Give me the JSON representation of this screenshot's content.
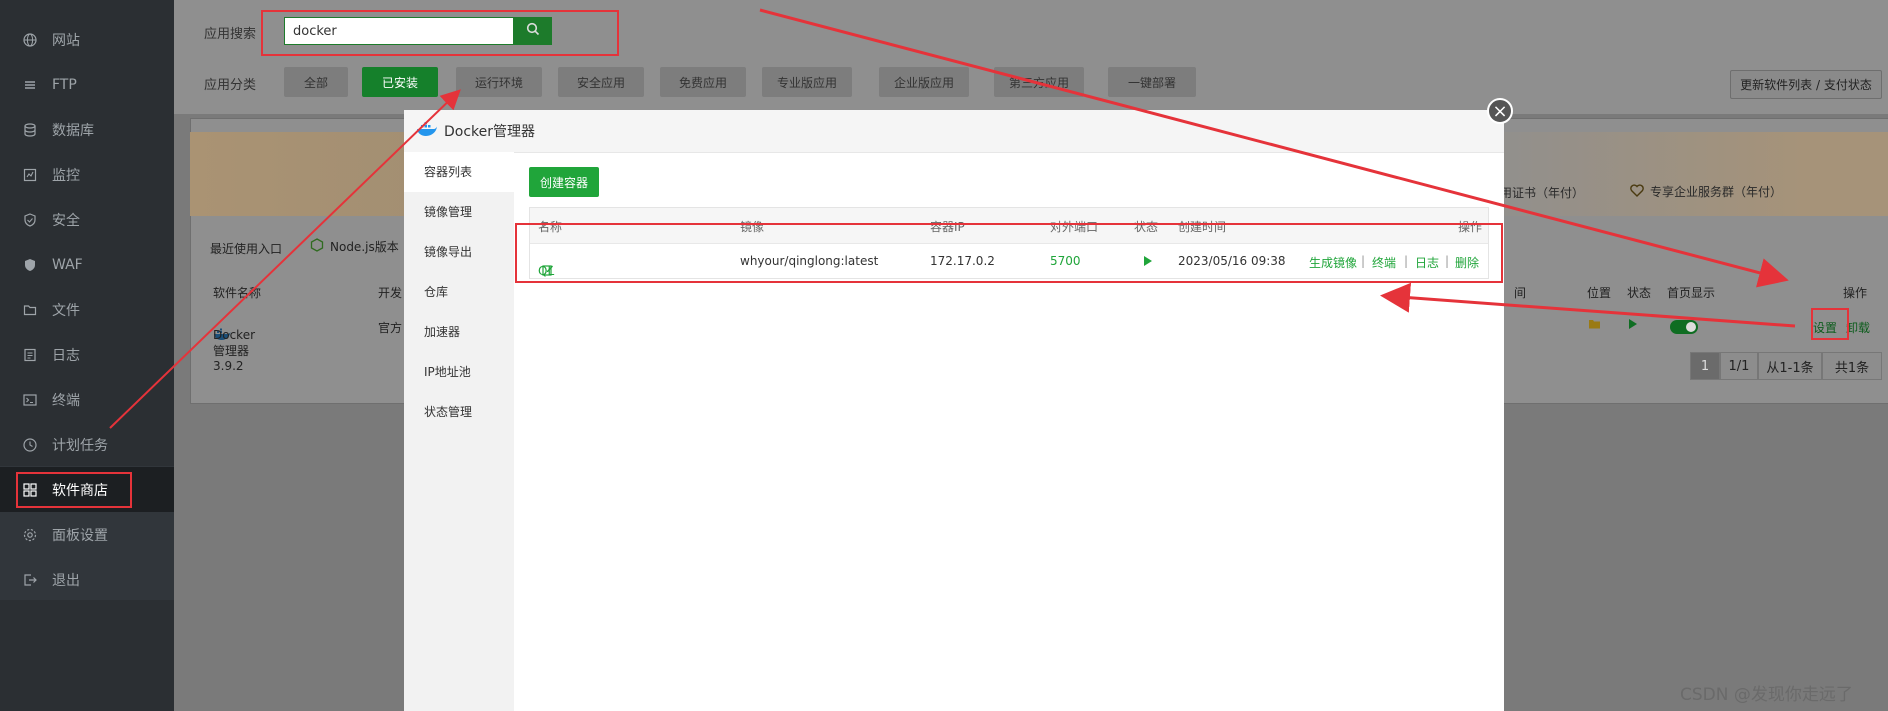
{
  "sidebar": {
    "items": [
      {
        "label": "网站",
        "icon": "globe-icon"
      },
      {
        "label": "FTP",
        "icon": "ftp-icon"
      },
      {
        "label": "数据库",
        "icon": "database-icon"
      },
      {
        "label": "监控",
        "icon": "monitor-icon"
      },
      {
        "label": "安全",
        "icon": "shield-icon"
      },
      {
        "label": "WAF",
        "icon": "waf-shield-icon"
      },
      {
        "label": "文件",
        "icon": "folder-icon"
      },
      {
        "label": "日志",
        "icon": "log-icon"
      },
      {
        "label": "终端",
        "icon": "terminal-icon"
      },
      {
        "label": "计划任务",
        "icon": "clock-icon"
      },
      {
        "label": "软件商店",
        "icon": "grid-icon",
        "active": true
      },
      {
        "label": "面板设置",
        "icon": "gear-icon"
      },
      {
        "label": "退出",
        "icon": "logout-icon"
      }
    ]
  },
  "search": {
    "label": "应用搜索",
    "value": "docker"
  },
  "category": {
    "label": "应用分类",
    "buttons": [
      "全部",
      "已安装",
      "运行环境",
      "安全应用",
      "免费应用",
      "专业版应用",
      "企业版应用",
      "第三方应用",
      "一键部署"
    ],
    "active_index": 1
  },
  "update_button": "更新软件列表 / 支付状态",
  "banner": {
    "cert_text": "用证书（年付）",
    "service_text": "专享企业服务群（年付）"
  },
  "recent": {
    "label": "最近使用入口",
    "node_text": "Node.js版本"
  },
  "soft_table": {
    "headers": {
      "name": "软件名称",
      "dev": "开发",
      "time": "间",
      "position": "位置",
      "status": "状态",
      "home": "首页显示",
      "ops": "操作"
    },
    "row": {
      "name": "Docker管理器 3.9.2",
      "dev": "官方",
      "settings": "设置",
      "uninstall": "卸载"
    }
  },
  "pagination": {
    "current": "1",
    "pages": "1/1",
    "range": "从1-1条",
    "total": "共1条"
  },
  "modal": {
    "title": "Docker管理器",
    "side_items": [
      "容器列表",
      "镜像管理",
      "镜像导出",
      "仓库",
      "加速器",
      "IP地址池",
      "状态管理"
    ],
    "active_side": 0,
    "create_button": "创建容器",
    "table": {
      "headers": {
        "name": "名称",
        "image": "镜像",
        "ip": "容器IP",
        "port": "对外端口",
        "status": "状态",
        "created": "创建时间",
        "ops": "操作"
      },
      "row": {
        "name": "QL",
        "image": "whyour/qinglong:latest",
        "ip": "172.17.0.2",
        "port": "5700",
        "created": "2023/05/16 09:38",
        "op_gen": "生成镜像",
        "op_term": "终端",
        "op_log": "日志",
        "op_del": "删除",
        "sep": "|"
      }
    }
  },
  "watermark": "CSDN @发现你走远了",
  "colors": {
    "accent": "#20a53a",
    "annotation": "#e5333a",
    "sidebar": "#2b2f33"
  }
}
